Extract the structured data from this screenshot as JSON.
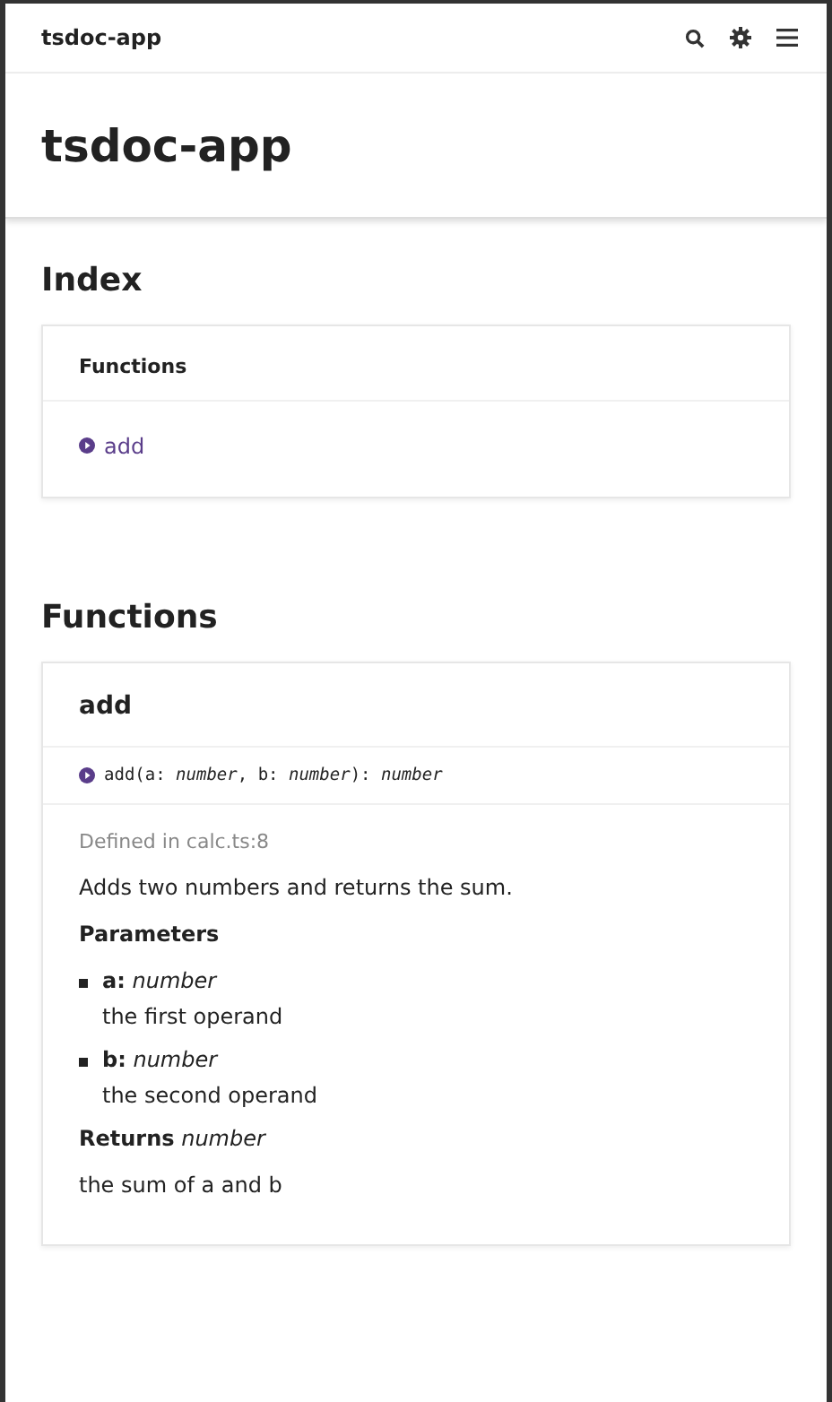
{
  "toolbar": {
    "title": "tsdoc-app"
  },
  "page_title": "tsdoc-app",
  "index": {
    "heading": "Index",
    "group_title": "Functions",
    "links": [
      "add"
    ]
  },
  "functions": {
    "heading": "Functions",
    "items": [
      {
        "name": "add",
        "signature": "add(a: *number*, b: *number*): *number*",
        "defined_in": "Defined in calc.ts:8",
        "description": "Adds two numbers and returns the sum.",
        "parameters_heading": "Parameters",
        "parameters": [
          {
            "name": "**a:** *number*",
            "description": "the first operand"
          },
          {
            "name": "**b:** *number*",
            "description": "the second operand"
          }
        ],
        "returns": "**Returns** *number*",
        "returns_description": "the sum of a and b"
      }
    ]
  }
}
